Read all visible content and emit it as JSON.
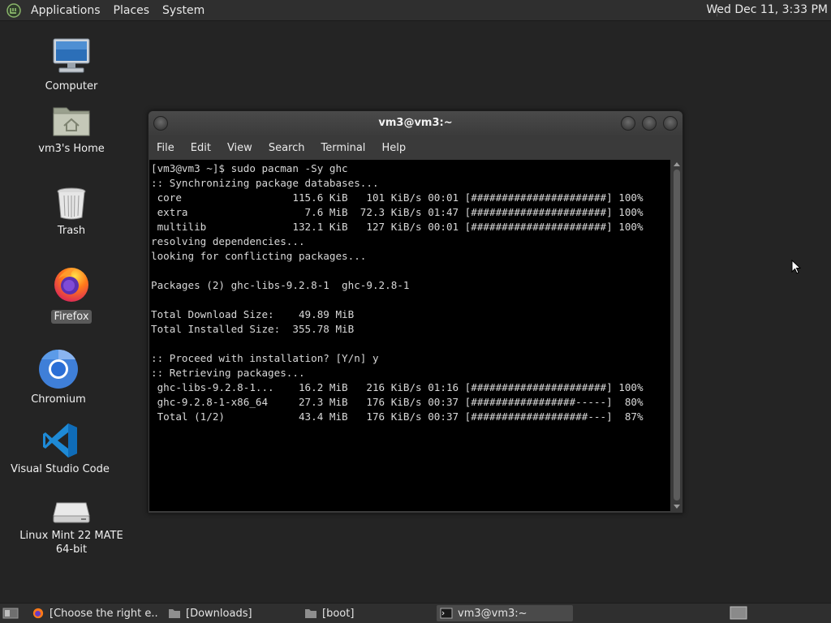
{
  "top_panel": {
    "menus": [
      "Applications",
      "Places",
      "System"
    ],
    "clock": "Wed Dec 11,  3:33 PM"
  },
  "desktop_icons": [
    {
      "name": "computer",
      "label": "Computer"
    },
    {
      "name": "home",
      "label": "vm3's Home"
    },
    {
      "name": "trash",
      "label": "Trash"
    },
    {
      "name": "firefox",
      "label": "Firefox"
    },
    {
      "name": "chromium",
      "label": "Chromium"
    },
    {
      "name": "vscode",
      "label": "Visual Studio Code"
    },
    {
      "name": "drive",
      "label_line1": "Linux Mint 22 MATE",
      "label_line2": "64-bit"
    }
  ],
  "terminal": {
    "title": "vm3@vm3:~",
    "menu": [
      "File",
      "Edit",
      "View",
      "Search",
      "Terminal",
      "Help"
    ],
    "lines": [
      "[vm3@vm3 ~]$ sudo pacman -Sy ghc",
      ":: Synchronizing package databases...",
      " core                  115.6 KiB   101 KiB/s 00:01 [######################] 100%",
      " extra                   7.6 MiB  72.3 KiB/s 01:47 [######################] 100%",
      " multilib              132.1 KiB   127 KiB/s 00:01 [######################] 100%",
      "resolving dependencies...",
      "looking for conflicting packages...",
      "",
      "Packages (2) ghc-libs-9.2.8-1  ghc-9.2.8-1",
      "",
      "Total Download Size:    49.89 MiB",
      "Total Installed Size:  355.78 MiB",
      "",
      ":: Proceed with installation? [Y/n] y",
      ":: Retrieving packages...",
      " ghc-libs-9.2.8-1...    16.2 MiB   216 KiB/s 01:16 [######################] 100%",
      " ghc-9.2.8-1-x86_64     27.3 MiB   176 KiB/s 00:37 [#################-----]  80%",
      " Total (1/2)            43.4 MiB   176 KiB/s 00:37 [###################---]  87%"
    ]
  },
  "taskbar": {
    "tasks": [
      {
        "label": "[Choose the right e..."
      },
      {
        "label": "[Downloads]"
      },
      {
        "label": "[boot]"
      },
      {
        "label": "vm3@vm3:~"
      }
    ]
  }
}
